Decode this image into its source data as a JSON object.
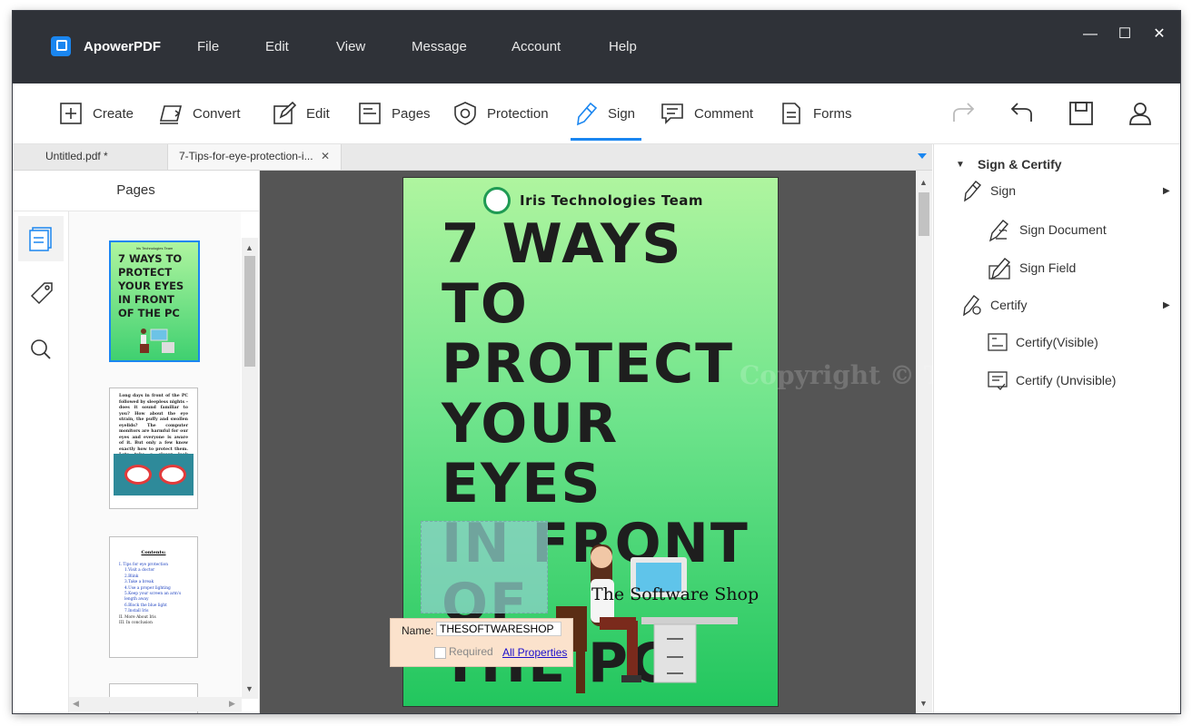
{
  "app": {
    "name": "ApowerPDF"
  },
  "menu": [
    "File",
    "Edit",
    "View",
    "Message",
    "Account",
    "Help"
  ],
  "window_controls": {
    "minimize": "—",
    "maximize": "☐",
    "close": "✕"
  },
  "toolbar": {
    "tools": [
      {
        "label": "Create",
        "icon": "create-icon"
      },
      {
        "label": "Convert",
        "icon": "convert-icon"
      },
      {
        "label": "Edit",
        "icon": "edit-icon"
      },
      {
        "label": "Pages",
        "icon": "pages-icon"
      },
      {
        "label": "Protection",
        "icon": "protection-icon"
      },
      {
        "label": "Sign",
        "icon": "sign-icon",
        "active": true
      },
      {
        "label": "Comment",
        "icon": "comment-icon"
      },
      {
        "label": "Forms",
        "icon": "forms-icon"
      }
    ],
    "right_icons": [
      "redo-icon",
      "undo-icon",
      "save-icon",
      "user-icon"
    ]
  },
  "tabs": [
    {
      "label": "Untitled.pdf *"
    },
    {
      "label": "7-Tips-for-eye-protection-i...",
      "selected": true
    }
  ],
  "pages_panel": {
    "title": "Pages",
    "side_icons": [
      "page-thumbnails-icon",
      "bookmark-tag-icon",
      "search-icon"
    ],
    "thumb1": {
      "team": "Iris Technologies Team",
      "title": "7 WAYS TO PROTECT YOUR EYES IN FRONT OF THE PC"
    },
    "thumb2": {
      "text": "Long days in front of the PC followed by sleepless nights – does it sound familiar to you? How about the eye strain, the puffy and swollen eyelids? The computer monitors are harmful for our eyes and everyone is aware of it. But only a few know exactly how to protect them. Lets take a closer look then..."
    },
    "thumb3": {
      "heading": "Contents:",
      "items": [
        "I.   Tips for eye protection",
        "1.Visit a doctor",
        "2.Blink",
        "3.Take a break",
        "4.Use a proper lighting",
        "5.Keep your screen an arm's length away",
        "6.Block the blue light",
        "7.Install Iris",
        "II.  More About Iris",
        "III. In conclusion"
      ]
    }
  },
  "document": {
    "team": "Iris Technologies Team",
    "title_lines": [
      "7 WAYS TO",
      "PROTECT",
      "YOUR EYES",
      "IN FRONT OF",
      "THE PC"
    ],
    "shop_text": "The Software Shop",
    "watermark": "Copyright © THESOFTWARE SHOP",
    "field_popup": {
      "name_label": "Name:",
      "name_value": "THESOFTWARESHOP",
      "required_label": "Required",
      "required_checked": false,
      "link": "All Properties"
    }
  },
  "sign_panel": {
    "header": "Sign & Certify",
    "sign": "Sign",
    "sign_document": "Sign Document",
    "sign_field": "Sign Field",
    "certify": "Certify",
    "certify_visible": "Certify(Visible)",
    "certify_unvisible": "Certify (Unvisible)"
  },
  "colors": {
    "titlebar": "#2f3238",
    "accent": "#1a86f0",
    "page_green_top": "#aff59f",
    "page_green_bottom": "#22c65e",
    "popup": "#fbe2cc"
  }
}
